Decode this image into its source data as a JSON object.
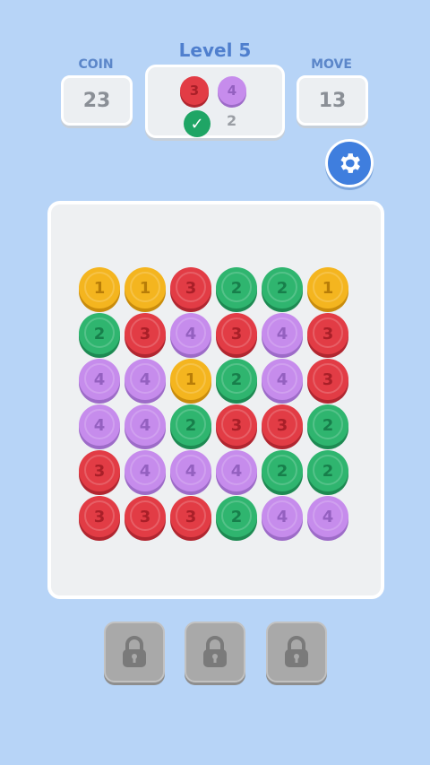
{
  "header": {
    "coin_label": "COIN",
    "coin_value": "23",
    "level_title": "Level 5",
    "move_label": "MOVE",
    "move_value": "13"
  },
  "goal": {
    "targets": [
      {
        "value": "3",
        "color": "red"
      },
      {
        "value": "4",
        "color": "purple"
      }
    ],
    "completed": "2"
  },
  "colors": {
    "yellow": "#f4b51f",
    "red": "#e23c45",
    "green": "#2fb56f",
    "purple": "#c68cec"
  },
  "board": {
    "rows": [
      [
        {
          "v": "1",
          "c": "yellow"
        },
        {
          "v": "1",
          "c": "yellow"
        },
        {
          "v": "3",
          "c": "red"
        },
        {
          "v": "2",
          "c": "green"
        },
        {
          "v": "2",
          "c": "green"
        },
        {
          "v": "1",
          "c": "yellow"
        }
      ],
      [
        {
          "v": "2",
          "c": "green"
        },
        {
          "v": "3",
          "c": "red"
        },
        {
          "v": "4",
          "c": "purple"
        },
        {
          "v": "3",
          "c": "red"
        },
        {
          "v": "4",
          "c": "purple"
        },
        {
          "v": "3",
          "c": "red"
        }
      ],
      [
        {
          "v": "4",
          "c": "purple"
        },
        {
          "v": "4",
          "c": "purple"
        },
        {
          "v": "1",
          "c": "yellow"
        },
        {
          "v": "2",
          "c": "green"
        },
        {
          "v": "4",
          "c": "purple"
        },
        {
          "v": "3",
          "c": "red"
        }
      ],
      [
        {
          "v": "4",
          "c": "purple"
        },
        {
          "v": "4",
          "c": "purple"
        },
        {
          "v": "2",
          "c": "green"
        },
        {
          "v": "3",
          "c": "red"
        },
        {
          "v": "3",
          "c": "red"
        },
        {
          "v": "2",
          "c": "green"
        }
      ],
      [
        {
          "v": "3",
          "c": "red"
        },
        {
          "v": "4",
          "c": "purple"
        },
        {
          "v": "4",
          "c": "purple"
        },
        {
          "v": "4",
          "c": "purple"
        },
        {
          "v": "2",
          "c": "green"
        },
        {
          "v": "2",
          "c": "green"
        }
      ],
      [
        {
          "v": "3",
          "c": "red"
        },
        {
          "v": "3",
          "c": "red"
        },
        {
          "v": "3",
          "c": "red"
        },
        {
          "v": "2",
          "c": "green"
        },
        {
          "v": "4",
          "c": "purple"
        },
        {
          "v": "4",
          "c": "purple"
        }
      ]
    ]
  },
  "slots": [
    {
      "icon": "lock-icon"
    },
    {
      "icon": "lock-icon"
    },
    {
      "icon": "lock-icon"
    }
  ]
}
